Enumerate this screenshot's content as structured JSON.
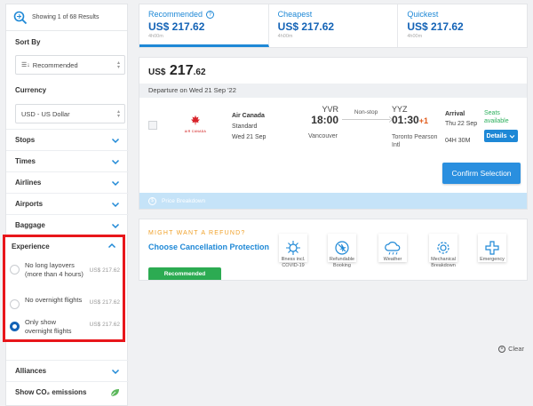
{
  "sidebar": {
    "results_text": "Showing 1 of 68 Results",
    "sort_by_label": "Sort By",
    "sort_value": "Recommended",
    "currency_label": "Currency",
    "currency_value": "USD - US Dollar",
    "filters": [
      "Stops",
      "Times",
      "Airlines",
      "Airports",
      "Baggage"
    ],
    "experience": {
      "label": "Experience",
      "options": [
        {
          "text": "No long layovers (more than 4 hours)",
          "price": "US$ 217.62",
          "selected": false
        },
        {
          "text": "No overnight flights",
          "price": "US$ 217.62",
          "selected": false
        },
        {
          "text": "Only show overnight flights",
          "price": "US$ 217.62",
          "selected": true
        }
      ],
      "clear": "Clear"
    },
    "alliances_label": "Alliances",
    "co2_label": "Show CO₂ emissions"
  },
  "tabs": [
    {
      "label": "Recommended",
      "price": "US$ 217.62",
      "sub": "4h00m",
      "active": true
    },
    {
      "label": "Cheapest",
      "price": "US$ 217.62",
      "sub": "4h00m",
      "active": false
    },
    {
      "label": "Quickest",
      "price": "US$ 217.62",
      "sub": "4h00m",
      "active": false
    }
  ],
  "result": {
    "price_currency": "US$",
    "price_int": "217",
    "price_dec": ".62",
    "departure_bar": "Departure on Wed 21 Sep '22",
    "airline_logo_text": "AIR CANADA",
    "airline_name": "Air Canada",
    "fare": "Standard",
    "date": "Wed 21 Sep",
    "dep_code": "YVR",
    "dep_time": "18:00",
    "dep_city": "Vancouver",
    "stops": "Non-stop",
    "arr_code": "YYZ",
    "arr_time": "01:30",
    "arr_plus": "+1",
    "arr_city_1": "Toronto Pearson",
    "arr_city_2": "Intl",
    "arrival_label": "Arrival",
    "arrival_date": "Thu 22 Sep",
    "duration": "04H 30M",
    "seats_1": "Seats",
    "seats_2": "available",
    "details_label": "Details",
    "confirm_label": "Confirm Selection",
    "breakdown_label": "Price Breakdown"
  },
  "protection": {
    "kicker": "MIGHT WANT A REFUND?",
    "title": "Choose Cancellation Protection",
    "recommended": "Recommended",
    "items": [
      {
        "label_1": "Illness incl.",
        "label_2": "COVID-19",
        "icon": "virus-icon"
      },
      {
        "label_1": "Refundable",
        "label_2": "Booking",
        "icon": "no-plane-icon"
      },
      {
        "label_1": "Weather",
        "label_2": "",
        "icon": "cloud-icon"
      },
      {
        "label_1": "Mechanical",
        "label_2": "Breakdown",
        "icon": "gear-icon"
      },
      {
        "label_1": "Emergency",
        "label_2": "",
        "icon": "medical-cross-icon"
      }
    ]
  },
  "colors": {
    "accent": "#1e88d6",
    "price_blue": "#1463b6",
    "highlight": "#e8161b",
    "green": "#2cab52",
    "orange": "#f0a12a"
  }
}
